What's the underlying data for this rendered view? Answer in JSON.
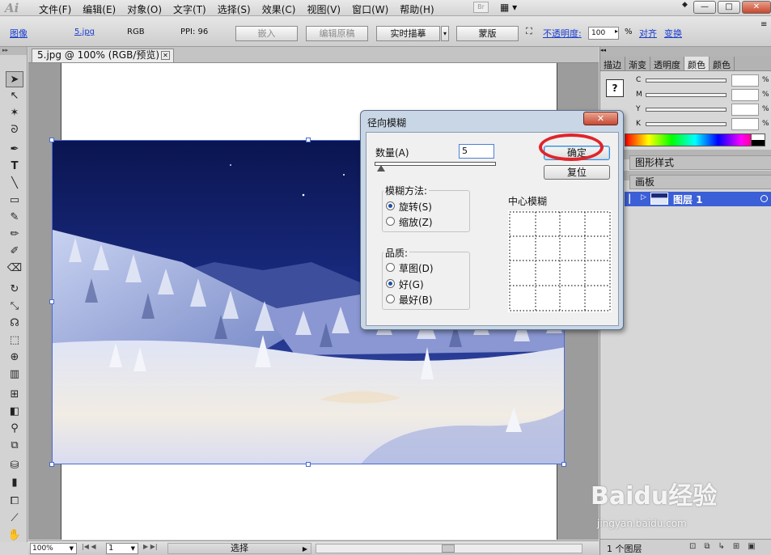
{
  "app": {
    "logo": "Ai",
    "bridge_badge": "Br",
    "essentials_icon": "◆"
  },
  "menu": [
    "文件(F)",
    "编辑(E)",
    "对象(O)",
    "文字(T)",
    "选择(S)",
    "效果(C)",
    "视图(V)",
    "窗口(W)",
    "帮助(H)"
  ],
  "window_buttons": {
    "minimize": "—",
    "restore": "□",
    "close": "✕"
  },
  "control_bar": {
    "kind": "图像",
    "filename": "5.jpg",
    "color_mode": "RGB",
    "ppi": "PPI: 96",
    "embed": "嵌入",
    "edit_original": "编辑原稿",
    "live_trace": "实时描摹",
    "mask": "蒙版",
    "opacity_label": "不透明度:",
    "opacity_value": "100",
    "percent": "%",
    "align": "对齐",
    "transform": "变换"
  },
  "document": {
    "tab_title": "5.jpg @ 100% (RGB/预览)",
    "tab_close": "✕",
    "zoom": "100%",
    "page": "1",
    "status": "选择"
  },
  "right_panel": {
    "tabs": [
      "描边",
      "渐变",
      "透明度",
      "颜色",
      "颜色"
    ],
    "cmyk": [
      {
        "label": "C",
        "unit": "%"
      },
      {
        "label": "M",
        "unit": "%"
      },
      {
        "label": "Y",
        "unit": "%"
      },
      {
        "label": "K",
        "unit": "%"
      }
    ],
    "fill_icon": "?",
    "graphic_styles": "图形样式",
    "artboard": "画板",
    "layer_name": "图层 1",
    "layer_count": "1 个图层"
  },
  "dialog": {
    "title": "径向模糊",
    "close": "✕",
    "amount_label": "数量(A)",
    "amount_value": "5",
    "amount_slider_fraction": 0.05,
    "method_label": "模糊方法:",
    "method_options": [
      "旋转(S)",
      "缩放(Z)"
    ],
    "method_selected": 0,
    "quality_label": "品质:",
    "quality_options": [
      "草图(D)",
      "好(G)",
      "最好(B)"
    ],
    "quality_selected": 1,
    "center_label": "中心模糊",
    "ok": "确定",
    "reset": "复位",
    "highlight_color": "#e0242b"
  },
  "watermark": {
    "text": "Baidu经验",
    "url": "jingyan.baidu.com"
  }
}
